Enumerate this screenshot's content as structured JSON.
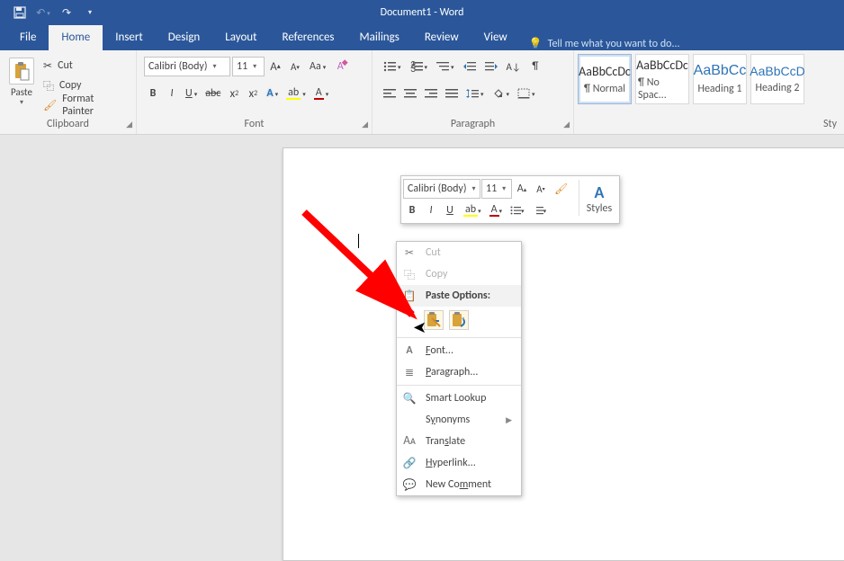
{
  "title": "Document1 - Word",
  "tabs": [
    "File",
    "Home",
    "Insert",
    "Design",
    "Layout",
    "References",
    "Mailings",
    "Review",
    "View"
  ],
  "tellme": "Tell me what you want to do...",
  "clipboard": {
    "paste": "Paste",
    "cut": "Cut",
    "copy": "Copy",
    "formatpainter": "Format Painter",
    "label": "Clipboard"
  },
  "font": {
    "name": "Calibri (Body)",
    "size": "11",
    "label": "Font"
  },
  "paragraph": {
    "label": "Paragraph"
  },
  "styles": {
    "label": "Sty",
    "tiles": [
      {
        "name": "¶ Normal",
        "prev": "AaBbCcDc"
      },
      {
        "name": "¶ No Spac...",
        "prev": "AaBbCcDc"
      },
      {
        "name": "Heading 1",
        "prev": "AaBbCc"
      },
      {
        "name": "Heading 2",
        "prev": "AaBbCcD"
      }
    ]
  },
  "mini": {
    "font": "Calibri (Body)",
    "size": "11",
    "styles": "Styles"
  },
  "ctx": {
    "cut": "Cut",
    "copy": "Copy",
    "pasteoptions": "Paste Options:",
    "font": "Font...",
    "paragraph": "Paragraph...",
    "smartlookup": "Smart Lookup",
    "synonyms": "Synonyms",
    "translate": "Translate",
    "hyperlink": "Hyperlink...",
    "newcomment": "New Comment"
  }
}
